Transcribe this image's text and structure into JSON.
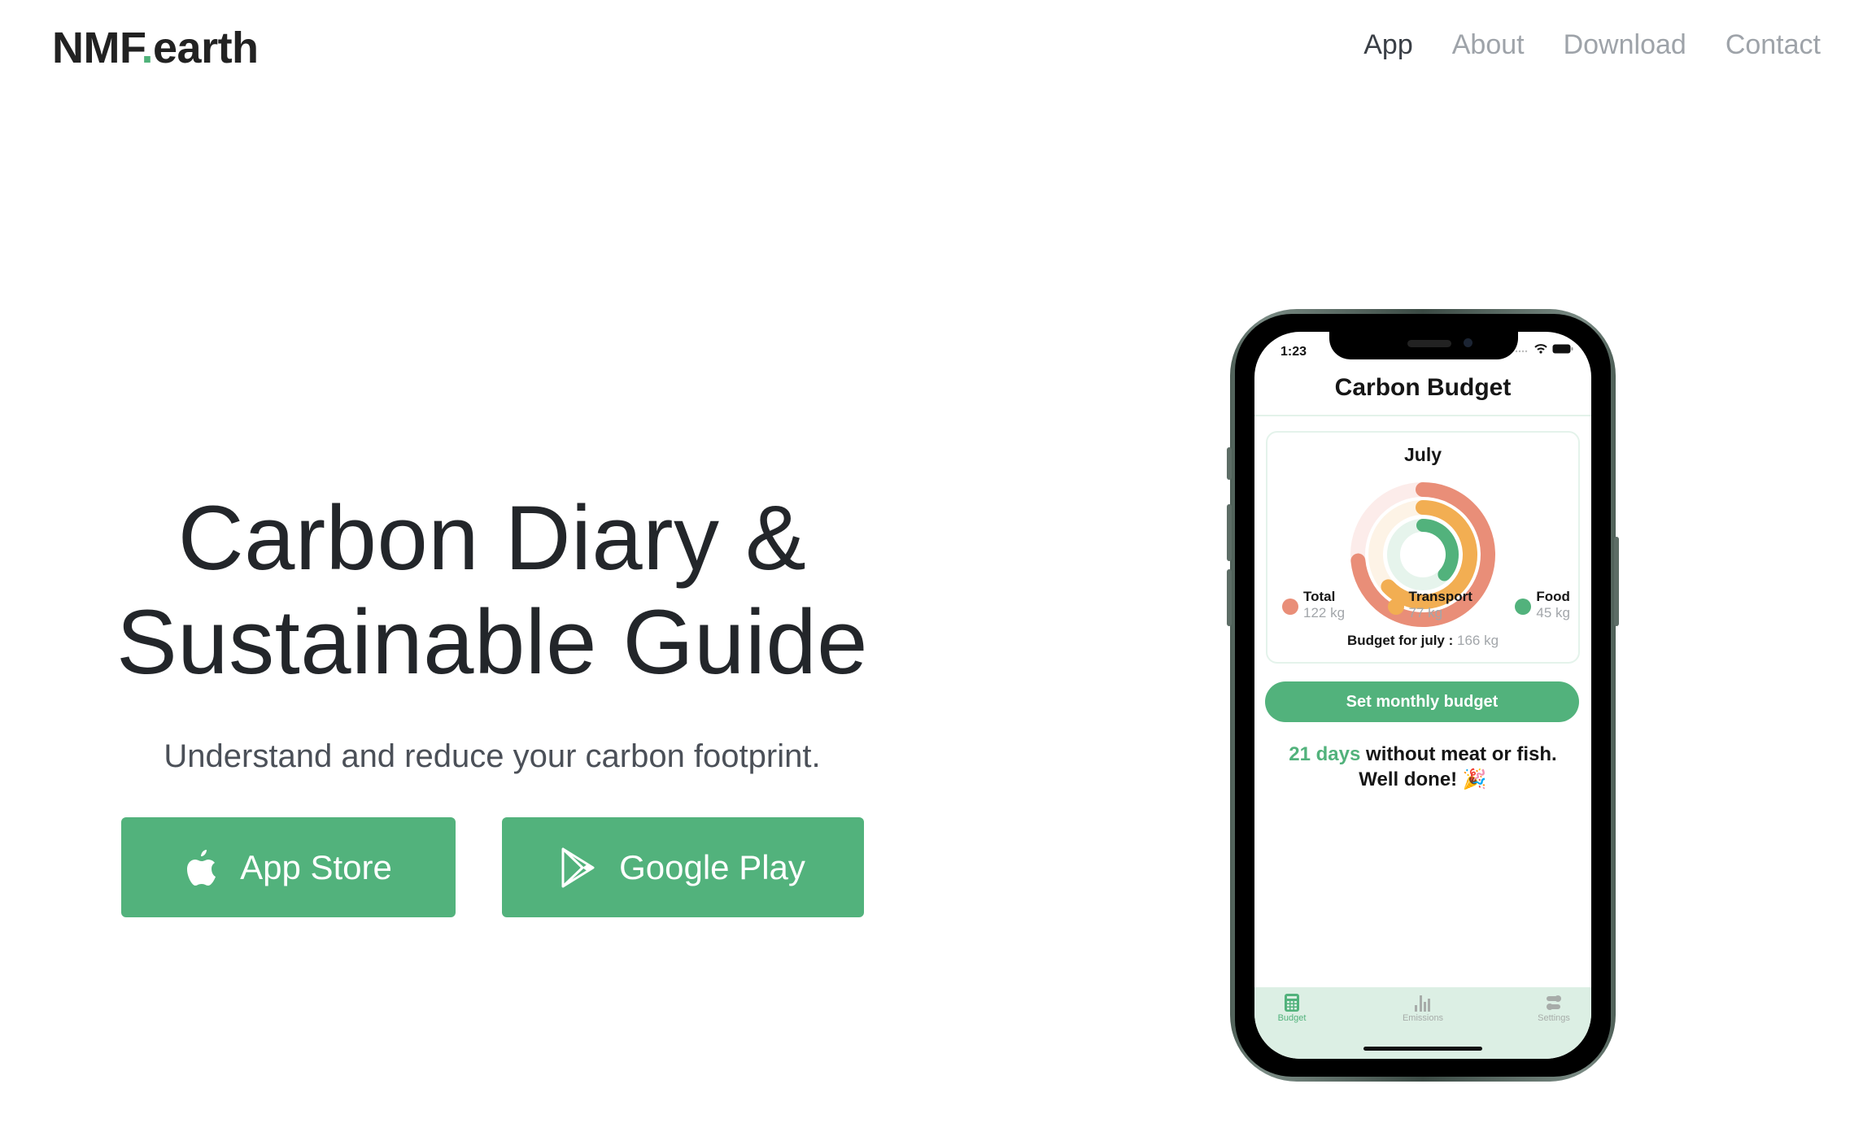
{
  "brand": {
    "name_part1": "NMF",
    "dot": ".",
    "name_part2": "earth",
    "accent": "#52b27c"
  },
  "nav": {
    "items": [
      {
        "label": "App",
        "active": true
      },
      {
        "label": "About",
        "active": false
      },
      {
        "label": "Download",
        "active": false
      },
      {
        "label": "Contact",
        "active": false
      }
    ]
  },
  "hero": {
    "title_line1": "Carbon Diary &",
    "title_line2": "Sustainable Guide",
    "subtitle": "Understand and reduce your carbon footprint."
  },
  "buttons": {
    "app_store": {
      "label": "App Store",
      "icon": "apple-icon"
    },
    "google_play": {
      "label": "Google Play",
      "icon": "play-store-icon"
    }
  },
  "phone": {
    "status_time": "1:23",
    "screen_title": "Carbon Budget",
    "card": {
      "month": "July",
      "legend": [
        {
          "label": "Total",
          "value": "122 kg",
          "color": "#e98e78"
        },
        {
          "label": "Transport",
          "value": "77 kg",
          "color": "#f2ae52"
        },
        {
          "label": "Food",
          "value": "45 kg",
          "color": "#52b27c"
        }
      ],
      "budget_label": "Budget for july :",
      "budget_value": "166 kg"
    },
    "set_budget_label": "Set monthly budget",
    "streak_highlight": "21 days",
    "streak_text": "without meat or fish.",
    "streak_line2": "Well done! 🎉",
    "tabs": [
      {
        "label": "Budget",
        "icon": "calculator-icon",
        "active": true
      },
      {
        "label": "Emissions",
        "icon": "bar-chart-icon",
        "active": false
      },
      {
        "label": "Settings",
        "icon": "toggles-icon",
        "active": false
      }
    ]
  },
  "chart_data": {
    "type": "pie",
    "title": "July",
    "series": [
      {
        "name": "Total",
        "value": 122,
        "max": 166,
        "color": "#e98e78"
      },
      {
        "name": "Transport",
        "value": 77,
        "max": 122,
        "color": "#f2ae52"
      },
      {
        "name": "Food",
        "value": 45,
        "max": 122,
        "color": "#52b27c"
      }
    ],
    "budget": 166,
    "unit": "kg"
  }
}
